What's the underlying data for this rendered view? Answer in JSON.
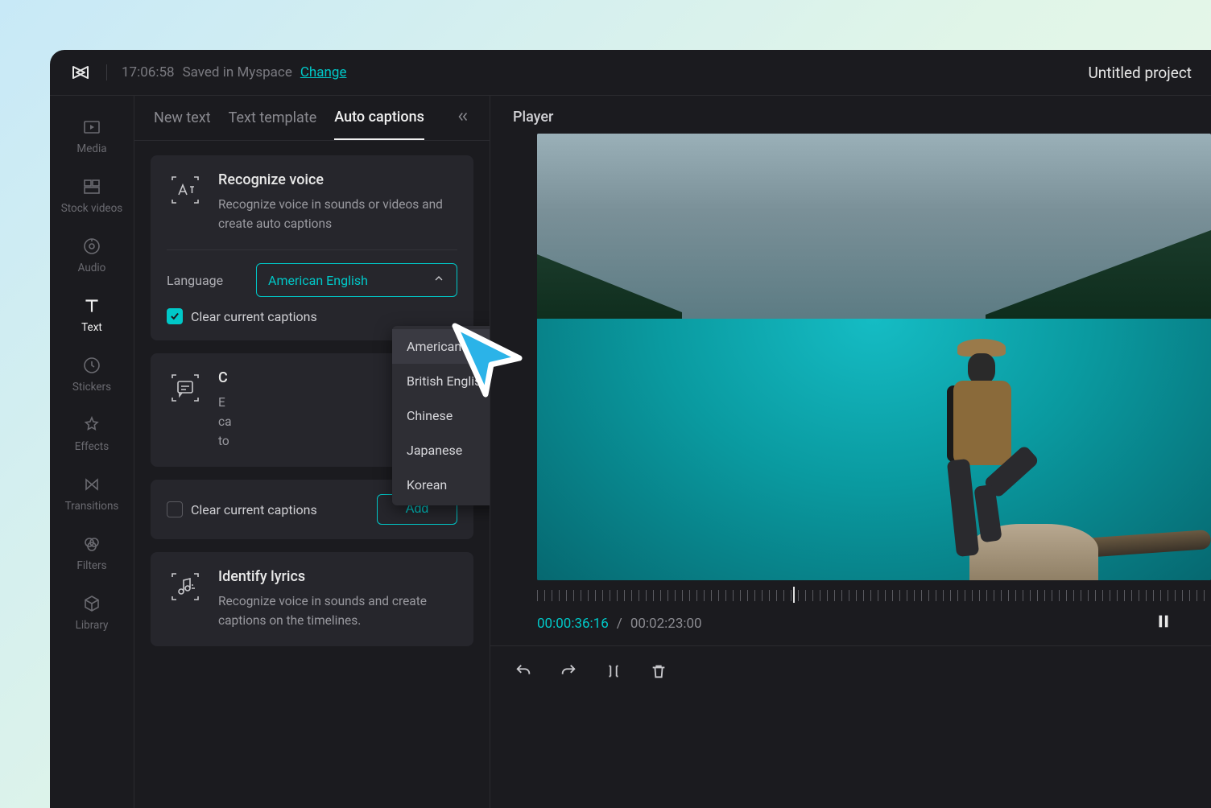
{
  "topbar": {
    "timestamp": "17:06:58",
    "saved_text": "Saved in Myspace",
    "change_link": "Change",
    "project_title": "Untitled project"
  },
  "rail": {
    "items": [
      {
        "label": "Media"
      },
      {
        "label": "Stock videos"
      },
      {
        "label": "Audio"
      },
      {
        "label": "Text"
      },
      {
        "label": "Stickers"
      },
      {
        "label": "Effects"
      },
      {
        "label": "Transitions"
      },
      {
        "label": "Filters"
      },
      {
        "label": "Library"
      }
    ]
  },
  "tabs": {
    "new_text": "New text",
    "text_template": "Text template",
    "auto_captions": "Auto captions"
  },
  "recognize": {
    "title": "Recognize voice",
    "desc": "Recognize voice in sounds or videos and create auto captions",
    "language_label": "Language",
    "selected": "American English",
    "clear_label": "Clear current captions"
  },
  "languages": {
    "opt0": "American English",
    "opt1": "British English",
    "opt2": "Chinese",
    "opt3": "Japanese",
    "opt4": "Korean"
  },
  "captions": {
    "title": "C",
    "desc_partial": "E\nca\nto",
    "clear_label2": "Clear current captions",
    "add_btn": "Add"
  },
  "lyrics": {
    "title": "Identify lyrics",
    "desc": "Recognize voice in sounds and create captions on the timelines."
  },
  "player": {
    "header": "Player",
    "current": "00:00:36:16",
    "sep": "/",
    "total": "00:02:23:00"
  }
}
